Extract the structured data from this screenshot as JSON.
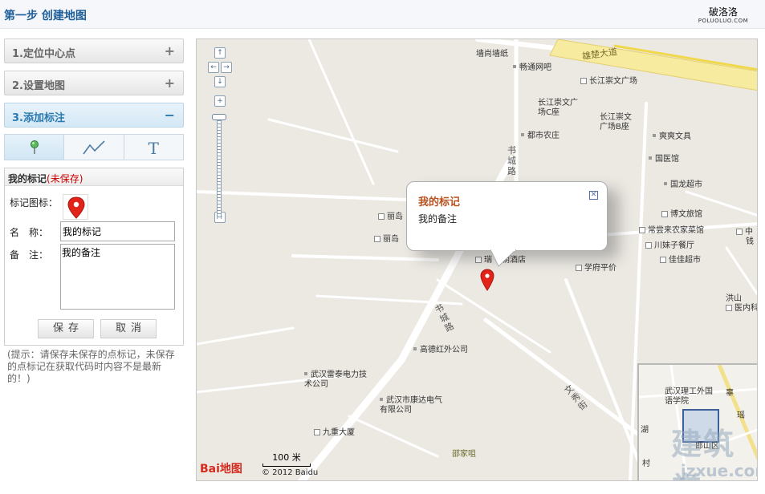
{
  "header": {
    "step_title": "第一步 创建地图",
    "logo_cn": "破洛洛",
    "logo_en": "POLUOLUO.COM"
  },
  "sidebar": {
    "sections": [
      {
        "label": "1.定位中心点",
        "sign": "+"
      },
      {
        "label": "2.设置地图",
        "sign": "+"
      },
      {
        "label": "3.添加标注",
        "sign": "−"
      }
    ],
    "tools": {
      "text_tool_glyph": "T"
    },
    "marker_panel": {
      "title": "我的标记",
      "unsaved": "(未保存)",
      "icon_label": "标记图标：",
      "name_label": "名　称：",
      "note_label": "备　注：",
      "name_value": "我的标记",
      "note_value": "我的备注",
      "save_label": "保存",
      "cancel_label": "取消"
    },
    "tip": "(提示：请保存未保存的点标记，未保存的点标记在获取代码时内容不是最新的！)"
  },
  "map": {
    "infowindow": {
      "title": "我的标记",
      "note": "我的备注"
    },
    "pois": [
      "墙尚墙纸",
      "畅通网吧",
      "长江崇文广场",
      "长江崇文广场C座",
      "长江崇文广场B座",
      "都市农庄",
      "爽爽文具",
      "国医馆",
      "国龙超市",
      "博文旅馆",
      "常尝来农家菜馆",
      "川妹子餐厅",
      "佳佳超市",
      "瑞",
      "朝酒店",
      "学府平价",
      "丽岛",
      "丽岛",
      "高德红外公司",
      "武汉雷泰电力技术公司",
      "武汉市康达电气有限公司",
      "九重大厦",
      "邵家咀",
      "中",
      "钱",
      "洪山",
      "医内科"
    ],
    "roads": [
      "雄楚大道",
      "书城路",
      "书城路",
      "文秀街"
    ],
    "overview": {
      "labels": [
        "武汉理工外国语学院",
        "郎山区",
        "湖",
        "村",
        "辜",
        "瑶"
      ]
    },
    "scale": "100 米",
    "copyright": "© 2012 Baidu",
    "baidu_logo": "Bai地图",
    "watermark": "建筑学",
    "watermark_url": "jzxue.com"
  },
  "colors": {
    "accent": "#2a7ab0",
    "marker": "#e2231a",
    "unsaved": "#cc0000",
    "info_title": "#b9521e"
  }
}
